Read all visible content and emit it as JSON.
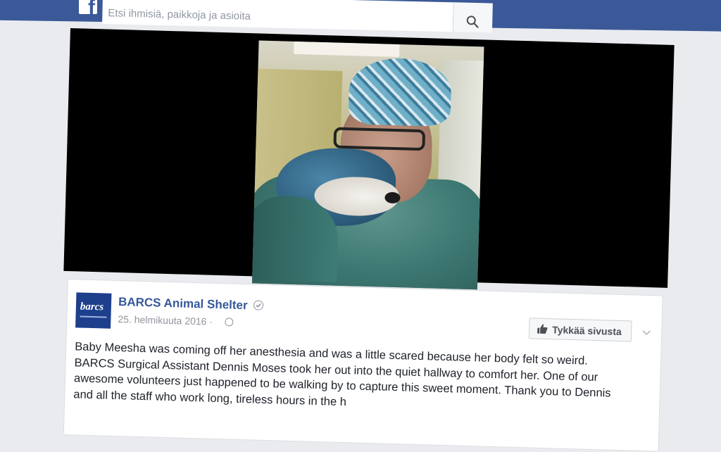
{
  "search": {
    "placeholder": "Etsi ihmisiä, paikkoja ja asioita"
  },
  "icons": {
    "logo": "facebook-logo",
    "search": "search-icon",
    "verified": "verified-check-icon",
    "privacy": "globe-icon",
    "like": "thumbs-up-icon",
    "menu": "chevron-down-icon"
  },
  "colors": {
    "brand": "#3b5998",
    "link": "#365899",
    "background": "#e9ebee"
  },
  "post": {
    "page_name": "BARCS Animal Shelter",
    "date": "25. helmikuuta 2016 ·",
    "avatar_text": "barcs",
    "like_button": "Tykkää sivusta",
    "text_lines": [
      "Baby Meesha was coming off her anesthesia and was a little scared because her body felt so weird.",
      "BARCS Surgical Assistant Dennis Moses took her out into the quiet hallway to comfort her. One of our",
      "awesome volunteers just happened to be walking by to capture this sweet moment. Thank you to Dennis",
      "and all the staff who work long, tireless hours in the h"
    ]
  }
}
